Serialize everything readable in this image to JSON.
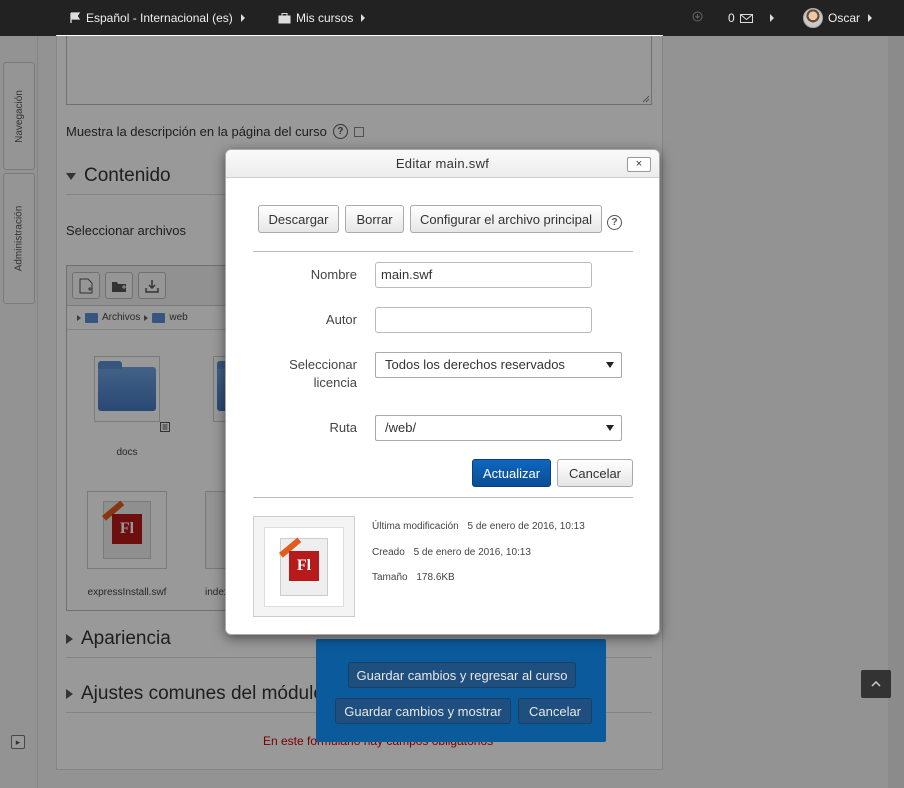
{
  "navbar": {
    "language": "Español - Internacional (es)",
    "my_courses": "Mis cursos",
    "messages_count": "0",
    "user_name": "Oscar"
  },
  "drawer": {
    "navigation": "Navegación",
    "administration": "Administración"
  },
  "form": {
    "show_description": "Muestra la descripción en la página del curso",
    "sections": {
      "content": "Contenido",
      "appearance": "Apariencia",
      "common_settings": "Ajustes comunes del módulo"
    },
    "select_files_label": "Seleccionar archivos",
    "required_notice": "En este formulario hay campos obligatorios"
  },
  "file_manager": {
    "path": [
      "Archivos",
      "web"
    ],
    "items": [
      {
        "name": "docs",
        "type": "folder"
      },
      {
        "name": "",
        "type": "folder"
      },
      {
        "name": "expressInstall.swf",
        "type": "flash"
      },
      {
        "name": "index_",
        "type": "flash"
      }
    ]
  },
  "save_bar": {
    "save_return": "Guardar cambios y regresar al curso",
    "save_show": "Guardar cambios y mostrar",
    "cancel": "Cancelar"
  },
  "dialog": {
    "title": "Editar main.swf",
    "close": "×",
    "download": "Descargar",
    "delete": "Borrar",
    "set_main": "Configurar el archivo principal",
    "name_label": "Nombre",
    "name_value": "main.swf",
    "author_label": "Autor",
    "author_value": "",
    "license_label": "Seleccionar licencia",
    "license_value": "Todos los derechos reservados",
    "path_label": "Ruta",
    "path_value": "/web/",
    "update": "Actualizar",
    "cancel": "Cancelar",
    "meta": {
      "modified_label": "Última modificación",
      "modified_value": "5 de enero de 2016, 10:13",
      "created_label": "Creado",
      "created_value": "5 de enero de 2016, 10:13",
      "size_label": "Tamaño",
      "size_value": "178.6KB"
    }
  },
  "colors": {
    "navbar": "#222222",
    "primary": "#0a5a9c",
    "required": "#cc0000"
  }
}
